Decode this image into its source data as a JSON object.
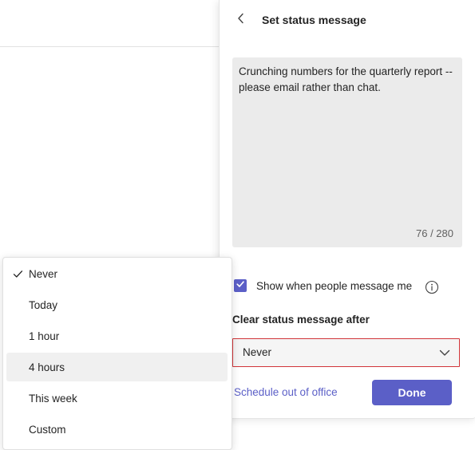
{
  "panel": {
    "title": "Set status message",
    "message": {
      "text": "Crunching numbers for the quarterly report -- please email rather than chat.",
      "counter": "76 / 280"
    },
    "show_when_messaged": {
      "checked": true,
      "label": "Show when people message me"
    },
    "clear_after": {
      "label": "Clear status message after",
      "selected": "Never"
    },
    "schedule_link": "Schedule out of office",
    "done_label": "Done"
  },
  "dropdown": {
    "options": [
      {
        "label": "Never",
        "selected": true
      },
      {
        "label": "Today",
        "selected": false
      },
      {
        "label": "1 hour",
        "selected": false
      },
      {
        "label": "4 hours",
        "selected": false,
        "highlighted": true
      },
      {
        "label": "This week",
        "selected": false
      },
      {
        "label": "Custom",
        "selected": false
      }
    ]
  },
  "colors": {
    "accent": "#5b5fc7",
    "focus_border": "#d13438",
    "textarea_bg": "#ebebeb"
  },
  "icons": {
    "back": "chevron-left-icon",
    "checkbox": "checkmark-icon",
    "info": "info-icon",
    "select": "chevron-down-icon",
    "selected_option": "checkmark-icon"
  }
}
